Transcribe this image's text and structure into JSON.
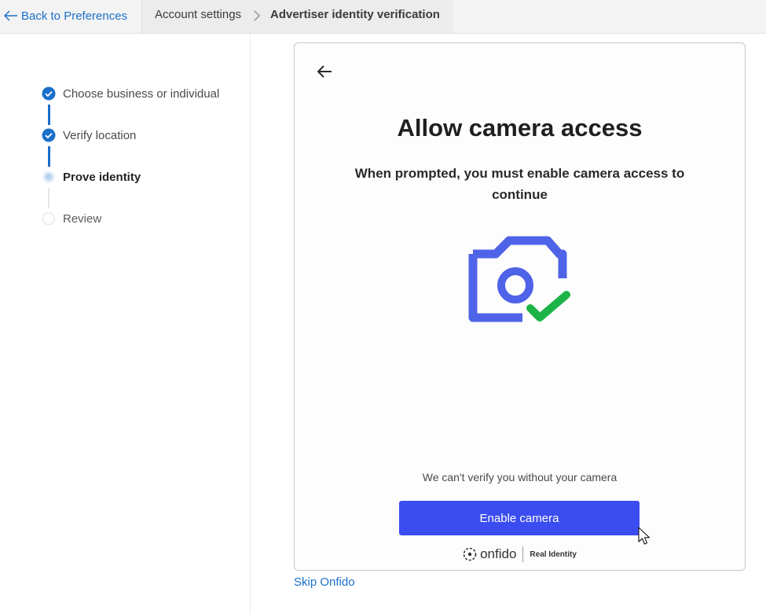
{
  "topbar": {
    "back_label": "Back to Preferences",
    "breadcrumb": {
      "account": "Account settings",
      "current": "Advertiser identity verification"
    }
  },
  "steps": [
    {
      "label": "Choose business or individual",
      "state": "complete"
    },
    {
      "label": "Verify location",
      "state": "complete"
    },
    {
      "label": "Prove identity",
      "state": "current"
    },
    {
      "label": "Review",
      "state": "upcoming"
    }
  ],
  "card": {
    "title": "Allow camera access",
    "subtitle": "When prompted, you must enable camera access to continue",
    "illustration_icon": "camera-check-icon",
    "note": "We can't verify you without your camera",
    "button_label": "Enable camera",
    "footer": {
      "brand": "onfido",
      "tagline": "Real Identity"
    }
  },
  "skip_label": "Skip Onfido",
  "colors": {
    "link": "#1a6fc9",
    "step_complete": "#1a6fc9",
    "button": "#3b4df0",
    "camera": "#4f63e8",
    "check": "#1db447"
  }
}
